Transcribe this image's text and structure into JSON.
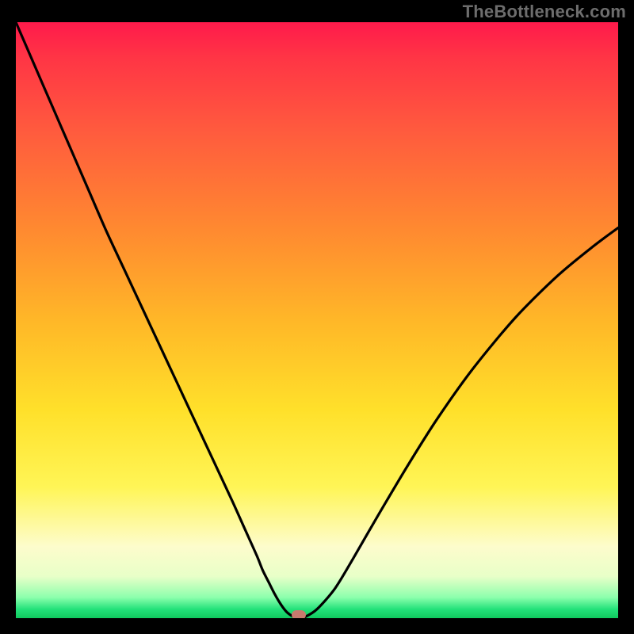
{
  "watermark": "TheBottleneck.com",
  "colors": {
    "curve": "#000000",
    "marker": "#c77a6e"
  },
  "chart_data": {
    "type": "line",
    "title": "",
    "xlabel": "",
    "ylabel": "",
    "xlim": [
      0,
      100
    ],
    "ylim": [
      0,
      100
    ],
    "grid": false,
    "x": [
      0,
      3,
      6,
      9,
      12,
      15,
      18,
      21,
      24,
      27,
      30,
      33,
      36,
      38,
      40,
      41,
      42,
      43,
      44,
      45,
      46,
      47,
      48,
      50,
      53,
      56,
      60,
      65,
      70,
      76,
      83,
      90,
      96,
      100
    ],
    "values": [
      100,
      93,
      86,
      79,
      72,
      65,
      58.5,
      52,
      45.5,
      39,
      32.5,
      26,
      19.5,
      15,
      10.5,
      8,
      6,
      4,
      2.3,
      1.0,
      0.3,
      0.0,
      0.2,
      1.5,
      5,
      10,
      17,
      25.5,
      33.5,
      42,
      50.5,
      57.5,
      62.5,
      65.5
    ],
    "marker": {
      "x": 47,
      "y": 0
    },
    "annotations": []
  }
}
